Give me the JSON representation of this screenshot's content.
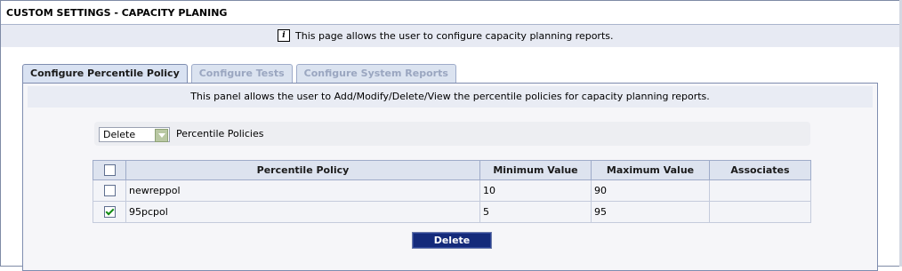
{
  "page": {
    "title": "CUSTOM SETTINGS - CAPACITY PLANING"
  },
  "info": {
    "icon": "info-icon",
    "glyph": "i",
    "text": "This page allows the user to configure capacity planning reports."
  },
  "tabs": [
    {
      "label": "Configure Percentile Policy",
      "active": true
    },
    {
      "label": "Configure Tests",
      "active": false
    },
    {
      "label": "Configure System Reports",
      "active": false
    }
  ],
  "panel": {
    "description": "This panel allows the user to Add/Modify/Delete/View the percentile policies for capacity planning reports.",
    "action_select": {
      "value": "Delete"
    },
    "filter_label": "Percentile Policies"
  },
  "table": {
    "columns": [
      "",
      "Percentile Policy",
      "Minimum Value",
      "Maximum Value",
      "Associates"
    ],
    "rows": [
      {
        "checked": false,
        "policy": "newreppol",
        "min": "10",
        "max": "90",
        "associates": ""
      },
      {
        "checked": true,
        "policy": "95pcpol",
        "min": "5",
        "max": "95",
        "associates": ""
      }
    ]
  },
  "actions": {
    "delete_label": "Delete"
  },
  "colors": {
    "accent": "#142a7a",
    "tab_active_bg": "#d9e2f2",
    "header_bg": "#dde3ef",
    "check": "#0f8a0f"
  }
}
